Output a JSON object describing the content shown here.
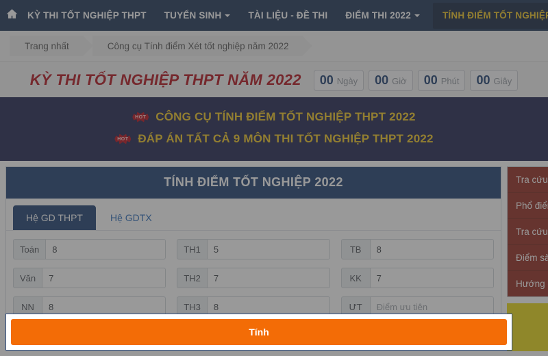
{
  "navbar": {
    "home_icon": "home-icon",
    "items": [
      {
        "label": "KỲ THI TỐT NGHIỆP THPT",
        "caret": false,
        "active": false
      },
      {
        "label": "TUYỂN SINH",
        "caret": true,
        "active": false
      },
      {
        "label": "TÀI LIỆU - ĐỀ THI",
        "caret": false,
        "active": false
      },
      {
        "label": "ĐIỂM THI 2022",
        "caret": true,
        "active": false
      },
      {
        "label": "TÍNH ĐIỂM TỐT NGHIỆP",
        "caret": false,
        "active": true
      }
    ],
    "bg_color": "#122a4f",
    "active_color": "#f0c419"
  },
  "breadcrumb": {
    "items": [
      "Trang nhất",
      "Công cụ Tính điểm Xét tốt nghiệp năm 2022"
    ]
  },
  "countdown": {
    "title": "KỲ THI TỐT NGHIỆP THPT NĂM 2022",
    "title_color": "#b00510",
    "units": [
      {
        "value": "00",
        "label": "Ngày"
      },
      {
        "value": "00",
        "label": "Giờ"
      },
      {
        "value": "00",
        "label": "Phút"
      },
      {
        "value": "00",
        "label": "Giây"
      }
    ]
  },
  "banner": {
    "bg_color": "#151a47",
    "text_color": "#f0c419",
    "rows": [
      {
        "badge": "HOT",
        "text": "CÔNG CỤ TÍNH ĐIỂM TỐT NGHIỆP THPT 2022"
      },
      {
        "badge": "HOT",
        "text": "ĐÁP ÁN TẤT CẢ 9 MÔN THI TỐT NGHIỆP THPT 2022"
      }
    ]
  },
  "panel": {
    "title": "TÍNH ĐIỂM TỐT NGHIỆP 2022",
    "tabs": [
      {
        "label": "Hệ GD THPT",
        "active": true
      },
      {
        "label": "Hệ GDTX",
        "active": false
      }
    ],
    "rows": [
      [
        {
          "name": "toan",
          "addon": "Toán",
          "value": "8",
          "placeholder": ""
        },
        {
          "name": "th1",
          "addon": "TH1",
          "value": "5",
          "placeholder": ""
        },
        {
          "name": "tb",
          "addon": "TB",
          "value": "8",
          "placeholder": ""
        }
      ],
      [
        {
          "name": "van",
          "addon": "Văn",
          "value": "7",
          "placeholder": ""
        },
        {
          "name": "th2",
          "addon": "TH2",
          "value": "7",
          "placeholder": ""
        },
        {
          "name": "kk",
          "addon": "KK",
          "value": "7",
          "placeholder": ""
        }
      ],
      [
        {
          "name": "nn",
          "addon": "NN",
          "value": "8",
          "placeholder": ""
        },
        {
          "name": "th3",
          "addon": "TH3",
          "value": "8",
          "placeholder": ""
        },
        {
          "name": "ut",
          "addon": "ƯT",
          "value": "",
          "placeholder": "Điểm ưu tiên"
        }
      ]
    ]
  },
  "sidebar": {
    "bg_color": "#8f2115",
    "items": [
      "Tra cứu điểm thi",
      "Phổ điểm thi",
      "Tra cứu điểm chuẩn",
      "Điểm sàn đại học",
      "Hướng dẫn đăng ký"
    ],
    "promo_color": "#e8d80b"
  },
  "submit": {
    "label": "Tính",
    "color": "#f36c06"
  }
}
